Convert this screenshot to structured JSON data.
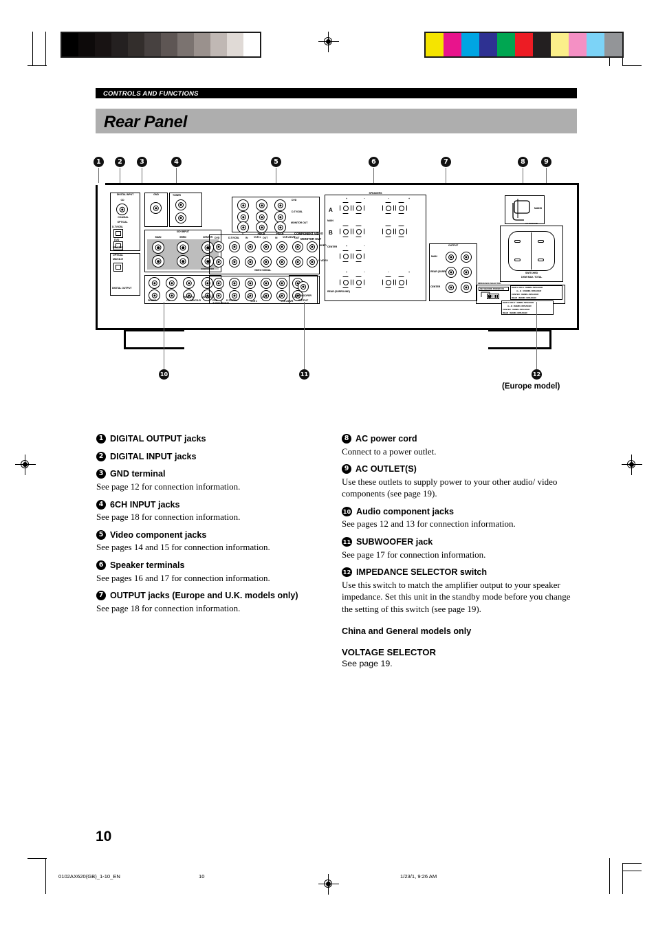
{
  "document": {
    "section_label": "CONTROLS AND FUNCTIONS",
    "page_title": "Rear Panel",
    "page_number": "10"
  },
  "footer": {
    "file_id": "0102AX620(GB)_1-10_EN",
    "page": "10",
    "timestamp": "1/23/1, 9:26 AM"
  },
  "diagram": {
    "model_note": "(Europe model)",
    "callouts_top": [
      "1",
      "2",
      "3",
      "4",
      "5",
      "6",
      "7",
      "8",
      "9"
    ],
    "callouts_bottom": [
      "10",
      "11",
      "12"
    ],
    "panel_labels": {
      "digital_input": "DIGITAL INPUT",
      "digital_output": "DIGITAL OUTPUT",
      "coaxial": "COAXIAL",
      "optical": "OPTICAL",
      "cd": "CD",
      "dtv_cbl": "D-TV/CBL",
      "dvd": "DVD",
      "md_cdr": "MD/CD-R",
      "gnd": "GND",
      "tuner": "TUNER",
      "sixch_input": "6CH INPUT",
      "main": "MAIN",
      "surround": "SRRD",
      "center": "CENTER",
      "subwoofer_small": "SUBWOOFER",
      "phono": "PHONO",
      "in_play": "IN(PLAY)",
      "out_rec": "OUT(REC)",
      "component_video": "COMPONENT VIDEO",
      "monitor_out": "MONITOR OUT",
      "video": "VIDEO",
      "s_video": "S VIDEO",
      "video_signal": "VIDEO SIGNAL",
      "audio_signal": "AUDIO SIGNAL",
      "vcr1": "VCR 1",
      "vcr2": "VCR 2/DVR",
      "in": "IN",
      "out": "OUT",
      "y": "Y",
      "pb_cb": "PB/CB",
      "pr_cr": "PR/CR",
      "sub_woofer": "SUB WOOFER",
      "output": "OUTPUT",
      "speakers": "SPEAKERS",
      "spk_a": "A",
      "spk_b": "B",
      "rear_surround": "REAR (SURROUND)",
      "plus": "+",
      "minus": "−",
      "mains": "MAINS",
      "ac_outlets": "AC OUTLETS",
      "switched": "SWITCHED",
      "watt_max": "100W MAX. TOTAL",
      "impedance_selector": "IMPEDANCE SELECTOR",
      "set_before": "SET BEFORE POWER ON",
      "imp_rows_upper": [
        "MAIN A OR B : 8ΩMIN. /SPEAKER",
        "A + B : 16ΩMIN. /SPEAKER",
        "CENTER : 8ΩMIN. /SPEAKER",
        "REAR : 8ΩMIN. /SPEAKER"
      ],
      "imp_rows_lower": [
        "MAIN A OR B : 4ΩMIN. /SPEAKER",
        "A + B : 8ΩMIN. /SPEAKER",
        "CENTER : 6ΩMIN. /SPEAKER",
        "REAR : 6ΩMIN. /SPEAKER"
      ],
      "out_main": "MAIN",
      "out_rear": "REAR (SURROUND)",
      "out_center": "CENTER"
    }
  },
  "descriptions": {
    "left_column": [
      {
        "num": "1",
        "title": "DIGITAL OUTPUT jacks",
        "body": ""
      },
      {
        "num": "2",
        "title": "DIGITAL INPUT jacks",
        "body": ""
      },
      {
        "num": "3",
        "title": "GND terminal",
        "body": "See page 12 for connection information."
      },
      {
        "num": "4",
        "title": "6CH INPUT jacks",
        "body": "See page 18 for connection information."
      },
      {
        "num": "5",
        "title": "Video component jacks",
        "body": "See pages 14 and 15 for connection information."
      },
      {
        "num": "6",
        "title": "Speaker terminals",
        "body": "See pages 16 and 17 for connection information."
      },
      {
        "num": "7",
        "title": "OUTPUT jacks (Europe and U.K. models only)",
        "body": "See page 18 for connection information."
      }
    ],
    "right_column": [
      {
        "num": "8",
        "title": "AC power cord",
        "body": "Connect to a power outlet."
      },
      {
        "num": "9",
        "title": "AC OUTLET(S)",
        "body": "Use these outlets to supply power to your other audio/ video components (see page 19)."
      },
      {
        "num": "10",
        "title": "Audio component jacks",
        "body": "See pages 12 and 13 for connection information."
      },
      {
        "num": "11",
        "title": "SUBWOOFER jack",
        "body": "See page 17 for connection information."
      },
      {
        "num": "12",
        "title": "IMPEDANCE SELECTOR switch",
        "body": "Use this switch to match the amplifier output to your speaker impedance. Set this unit in the standby mode before you change the setting of this switch (see page 19)."
      }
    ],
    "right_extra": {
      "models_note": "China and General models only",
      "voltage_selector": "VOLTAGE SELECTOR",
      "voltage_body": "See page 19."
    }
  },
  "print_marks": {
    "grayscale": [
      "#000000",
      "#0d0a0a",
      "#181313",
      "#242020",
      "#332e2c",
      "#474140",
      "#5e5654",
      "#7b7370",
      "#9a918d",
      "#c0b8b4",
      "#e0dad6",
      "#ffffff"
    ],
    "colorbars": [
      "#f5e400",
      "#e8148c",
      "#00a5e3",
      "#2e3192",
      "#00a651",
      "#ed1c24",
      "#231f20",
      "#fbef8a",
      "#f490c4",
      "#7cd3f7",
      "#939598"
    ]
  }
}
